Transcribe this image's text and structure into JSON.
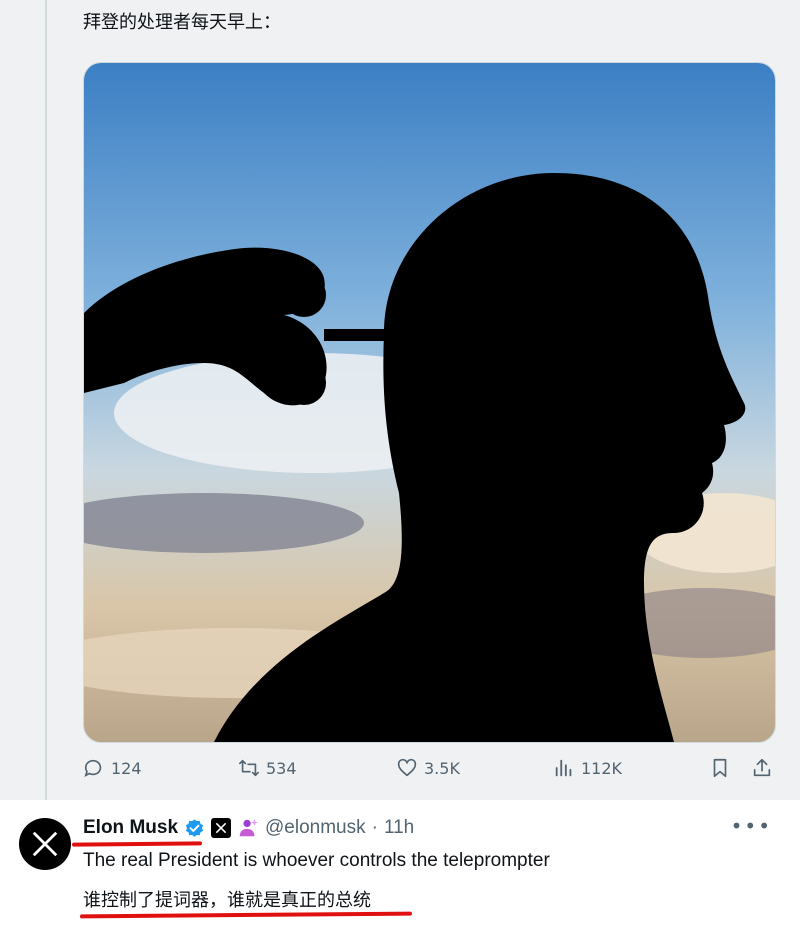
{
  "quoted_post": {
    "text": "拜登的处理者每天早上："
  },
  "actions": {
    "replies": "124",
    "reposts": "534",
    "likes": "3.5K",
    "views": "112K"
  },
  "tweet": {
    "author_name": "Elon Musk",
    "handle": "@elonmusk",
    "separator": "·",
    "time": "11h",
    "more_label": "•••",
    "text_en": "The real President is whoever controls the teleprompter",
    "text_zh": "谁控制了提词器，谁就是真正的总统"
  },
  "icons": {
    "reply": "reply-icon",
    "retweet": "retweet-icon",
    "like": "heart-icon",
    "views": "views-icon",
    "bookmark": "bookmark-icon",
    "share": "share-icon",
    "verified": "verified-badge-icon",
    "affiliate": "x-affiliate-icon",
    "emoji": "person-sparkle-icon"
  },
  "colors": {
    "verified": "#1d9bf0",
    "annotation": "#e01010",
    "muted_text": "#536471"
  }
}
